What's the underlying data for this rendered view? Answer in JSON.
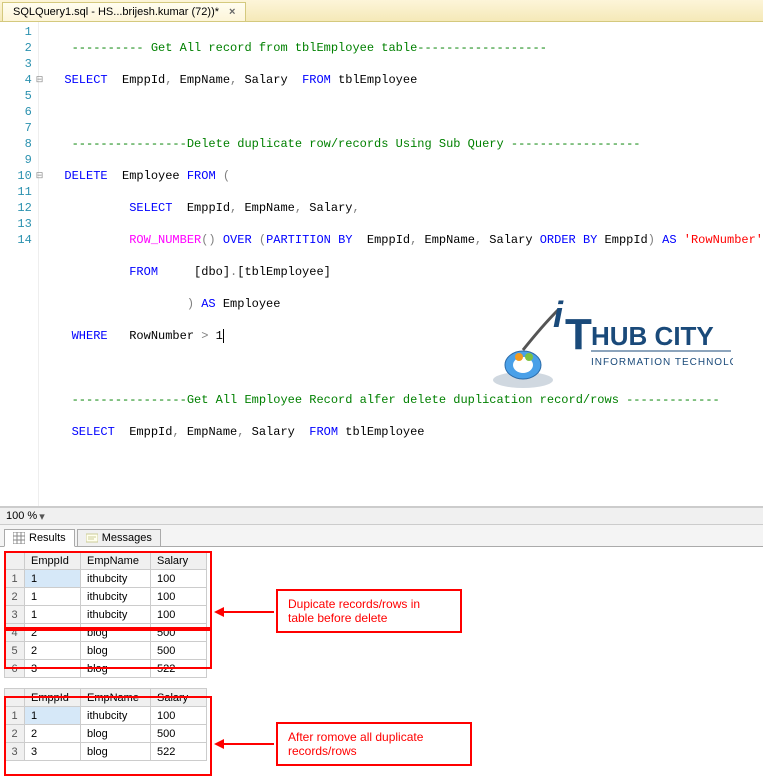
{
  "tab": {
    "title": "SQLQuery1.sql - HS...brijesh.kumar (72))*",
    "close": "×"
  },
  "gutter": [
    "1",
    "2",
    "3",
    "4",
    "5",
    "6",
    "7",
    "8",
    "9",
    "10",
    "11",
    "12",
    "13",
    "14"
  ],
  "code": {
    "l1_dashes1": "----------",
    "l1_comment": " Get All record from tblEmployee table",
    "l1_dashes2": "------------------",
    "l2_select": "SELECT",
    "l2_cols": "  EmppId",
    "l2_comma1": ",",
    "l2_c2": " EmpName",
    "l2_comma2": ",",
    "l2_c3": " Salary  ",
    "l2_from": "FROM",
    "l2_tbl": " tblEmployee",
    "l4_dashes1": "----------------",
    "l4_comment": "Delete duplicate row/records Using Sub Query ",
    "l4_dashes2": "------------------",
    "l5_delete": "DELETE",
    "l5_sp": "  Employee ",
    "l5_from": "FROM",
    "l5_paren": " (",
    "l6_select": "SELECT",
    "l6_cols": "  EmppId",
    "l6_comma1": ",",
    "l6_c2": " EmpName",
    "l6_comma2": ",",
    "l6_c3": " Salary",
    "l6_comma3": ",",
    "l7_rownum": "ROW_NUMBER",
    "l7_po": "()",
    "l7_sp": " ",
    "l7_over": "OVER",
    "l7_sp2": " ",
    "l7_po2": "(",
    "l7_part": "PARTITION",
    "l7_sp3": " ",
    "l7_by": "BY",
    "l7_cols": "  EmppId",
    "l7_comma1": ",",
    "l7_c2": " EmpName",
    "l7_comma2": ",",
    "l7_c3": " Salary ",
    "l7_order": "ORDER",
    "l7_sp4": " ",
    "l7_by2": "BY",
    "l7_c4": " EmppId",
    "l7_pc": ")",
    "l7_sp5": " ",
    "l7_as": "AS",
    "l7_sp6": " ",
    "l7_alias": "'RowNumber'",
    "l8_from": "FROM",
    "l8_sp": "     [dbo]",
    "l8_dot": ".",
    "l8_tbl": "[tblEmployee]",
    "l9_pc": ")",
    "l9_sp": " ",
    "l9_as": "AS",
    "l9_emp": " Employee",
    "l10_where": "WHERE",
    "l10_cond": "   RowNumber ",
    "l10_gt": ">",
    "l10_one": " 1",
    "l12_dashes1": "----------------",
    "l12_comment": "Get All Employee Record alfer delete duplication record/rows ",
    "l12_dashes2": "-------------",
    "l13_select": "SELECT",
    "l13_cols": "  EmppId",
    "l13_comma1": ",",
    "l13_c2": " EmpName",
    "l13_comma2": ",",
    "l13_c3": " Salary  ",
    "l13_from": "FROM",
    "l13_tbl": " tblEmployee"
  },
  "zoom": "100 %",
  "results_tab": "Results",
  "messages_tab": "Messages",
  "headers": {
    "c1": "EmppId",
    "c2": "EmpName",
    "c3": "Salary"
  },
  "grid1": [
    {
      "n": "1",
      "id": "1",
      "name": "ithubcity",
      "sal": "100"
    },
    {
      "n": "2",
      "id": "1",
      "name": "ithubcity",
      "sal": "100"
    },
    {
      "n": "3",
      "id": "1",
      "name": "ithubcity",
      "sal": "100"
    },
    {
      "n": "4",
      "id": "2",
      "name": "blog",
      "sal": "500"
    },
    {
      "n": "5",
      "id": "2",
      "name": "blog",
      "sal": "500"
    },
    {
      "n": "6",
      "id": "3",
      "name": "blog",
      "sal": "522"
    }
  ],
  "grid2": [
    {
      "n": "1",
      "id": "1",
      "name": "ithubcity",
      "sal": "100"
    },
    {
      "n": "2",
      "id": "2",
      "name": "blog",
      "sal": "500"
    },
    {
      "n": "3",
      "id": "3",
      "name": "blog",
      "sal": "522"
    }
  ],
  "annot1_l1": "Dupicate records/rows in",
  "annot1_l2": "table before delete",
  "annot2_l1": "After romove all duplicate",
  "annot2_l2": "records/rows",
  "logo": {
    "brand1": "HUB CITY",
    "brand2": "INFORMATION TECHNOLOGY"
  }
}
